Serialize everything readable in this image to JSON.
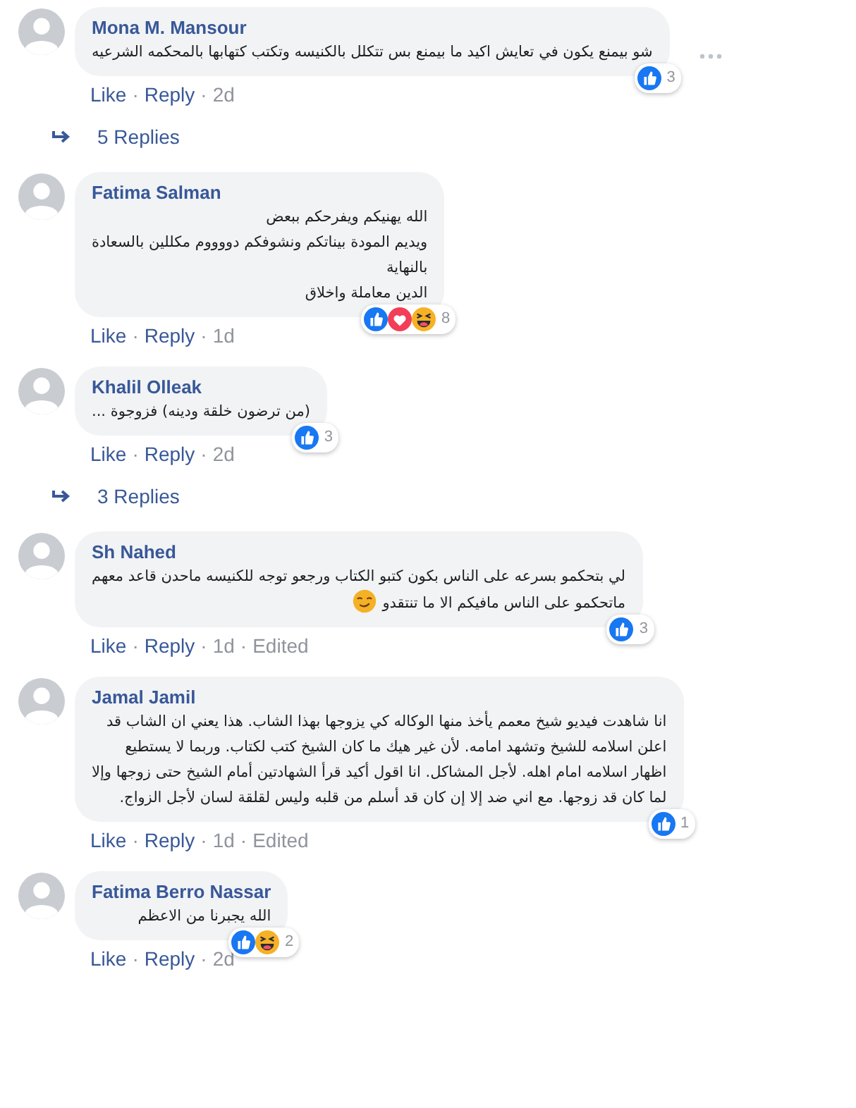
{
  "comments": [
    {
      "author": "Mona M. Mansour",
      "lines": [
        "شو بيمنع يكون في تعايش اكيد ما بيمنع بس تتكلل بالكنيسه وتكتب كتهابها بالمحكمه الشرعيه"
      ],
      "smirk_emoji": false,
      "reactions": [
        {
          "kind": "like"
        }
      ],
      "reaction_count": "3",
      "like_label": "Like",
      "reply_label": "Reply",
      "time": "2d",
      "edited": false,
      "menu": true,
      "replies": "5 Replies"
    },
    {
      "author": "Fatima Salman",
      "lines": [
        "الله يهنيكم ويفرحكم ببعض",
        "ويديم المودة بيناتكم ونشوفكم دووووم مكللين بالسعادة",
        "بالنهاية",
        "الدين معاملة واخلاق"
      ],
      "smirk_emoji": false,
      "reactions": [
        {
          "kind": "like"
        },
        {
          "kind": "love"
        },
        {
          "kind": "haha"
        }
      ],
      "reaction_count": "8",
      "like_label": "Like",
      "reply_label": "Reply",
      "time": "1d",
      "edited": false,
      "menu": false
    },
    {
      "author": "Khalil Olleak",
      "lines": [
        "(من ترضون خلقة ودينه) فزوجوة ..."
      ],
      "smirk_emoji": false,
      "reactions": [
        {
          "kind": "like"
        }
      ],
      "reaction_count": "3",
      "like_label": "Like",
      "reply_label": "Reply",
      "time": "2d",
      "edited": false,
      "menu": false,
      "replies": "3 Replies"
    },
    {
      "author": "Sh Nahed",
      "lines": [
        "لي بتحكمو بسرعه على الناس بكون كتبو الكتاب ورجعو توجه للكنيسه ماحدن قاعد معهم",
        "ماتحكمو على الناس مافيكم الا ما تنتقدو"
      ],
      "smirk_emoji": true,
      "reactions": [
        {
          "kind": "like"
        }
      ],
      "reaction_count": "3",
      "like_label": "Like",
      "reply_label": "Reply",
      "time": "1d",
      "edited": true,
      "edited_label": "Edited",
      "menu": false
    },
    {
      "author": "Jamal Jamil",
      "lines": [
        "انا شاهدت فيديو شيخ معمم يأخذ منها الوكاله كي يزوجها بهذا الشاب. هذا يعني ان الشاب قد",
        "اعلن اسلامه للشيخ وتشهد امامه. لأن غير هيك ما كان الشيخ كتب لكتاب. وربما لا يستطيع",
        "اظهار اسلامه امام اهله. لأجل المشاكل. انا اقول أكيد قرأ الشهادتين أمام الشيخ حتى زوجها وإلا",
        "لما كان قد زوجها. مع اني ضد إلا إن كان قد أسلم من قلبه وليس لقلقة لسان لأجل الزواج."
      ],
      "smirk_emoji": false,
      "reactions": [
        {
          "kind": "like"
        }
      ],
      "reaction_count": "1",
      "like_label": "Like",
      "reply_label": "Reply",
      "time": "1d",
      "edited": true,
      "edited_label": "Edited",
      "menu": false
    },
    {
      "author": "Fatima Berro Nassar",
      "lines": [
        "الله يجبرنا من الاعظم"
      ],
      "smirk_emoji": false,
      "reactions": [
        {
          "kind": "like"
        },
        {
          "kind": "haha"
        }
      ],
      "reaction_count": "2",
      "like_label": "Like",
      "reply_label": "Reply",
      "time": "2d",
      "edited": false,
      "menu": false
    }
  ],
  "separator": "·"
}
